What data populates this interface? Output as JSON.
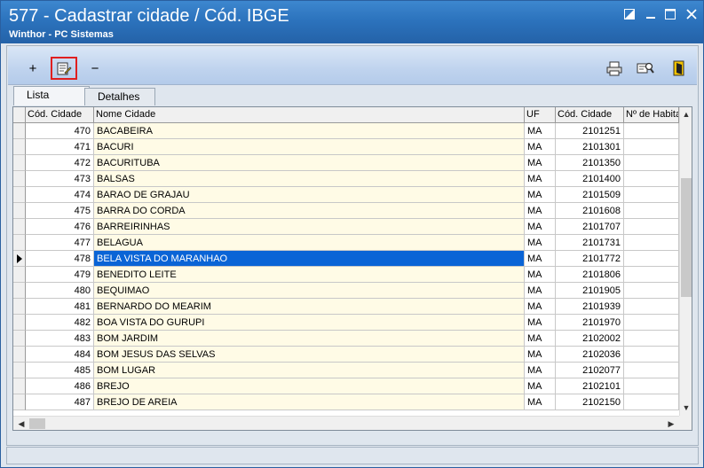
{
  "window": {
    "title": "577 - Cadastrar cidade / Cód. IBGE",
    "subtitle": "Winthor - PC Sistemas",
    "controls": [
      "restore-icon",
      "minimize-icon",
      "maximize-icon",
      "close-icon"
    ]
  },
  "toolbar": {
    "add": "+",
    "minus": "−",
    "buttons": [
      "add-icon",
      "edit-record-icon",
      "remove-icon",
      "print-icon",
      "search-icon",
      "exit-door-icon"
    ],
    "highlight_color": "#e01f1f"
  },
  "tabs": [
    {
      "label": "Lista",
      "active": true
    },
    {
      "label": "Detalhes",
      "active": false
    }
  ],
  "grid": {
    "columns": [
      "Cód. Cidade",
      "Nome Cidade",
      "UF",
      "Cód. Cidade",
      "Nº de Habita"
    ],
    "rows": [
      {
        "cod": "470",
        "nome": "BACABEIRA",
        "uf": "MA",
        "ibge": "2101251"
      },
      {
        "cod": "471",
        "nome": "BACURI",
        "uf": "MA",
        "ibge": "2101301"
      },
      {
        "cod": "472",
        "nome": "BACURITUBA",
        "uf": "MA",
        "ibge": "2101350"
      },
      {
        "cod": "473",
        "nome": "BALSAS",
        "uf": "MA",
        "ibge": "2101400"
      },
      {
        "cod": "474",
        "nome": "BARAO DE GRAJAU",
        "uf": "MA",
        "ibge": "2101509"
      },
      {
        "cod": "475",
        "nome": "BARRA DO CORDA",
        "uf": "MA",
        "ibge": "2101608"
      },
      {
        "cod": "476",
        "nome": "BARREIRINHAS",
        "uf": "MA",
        "ibge": "2101707"
      },
      {
        "cod": "477",
        "nome": "BELAGUA",
        "uf": "MA",
        "ibge": "2101731"
      },
      {
        "cod": "478",
        "nome": "BELA VISTA DO MARANHAO",
        "uf": "MA",
        "ibge": "2101772",
        "selected": true
      },
      {
        "cod": "479",
        "nome": "BENEDITO LEITE",
        "uf": "MA",
        "ibge": "2101806"
      },
      {
        "cod": "480",
        "nome": "BEQUIMAO",
        "uf": "MA",
        "ibge": "2101905"
      },
      {
        "cod": "481",
        "nome": "BERNARDO DO MEARIM",
        "uf": "MA",
        "ibge": "2101939"
      },
      {
        "cod": "482",
        "nome": "BOA VISTA DO GURUPI",
        "uf": "MA",
        "ibge": "2101970"
      },
      {
        "cod": "483",
        "nome": "BOM JARDIM",
        "uf": "MA",
        "ibge": "2102002"
      },
      {
        "cod": "484",
        "nome": "BOM JESUS DAS SELVAS",
        "uf": "MA",
        "ibge": "2102036"
      },
      {
        "cod": "485",
        "nome": "BOM LUGAR",
        "uf": "MA",
        "ibge": "2102077"
      },
      {
        "cod": "486",
        "nome": "BREJO",
        "uf": "MA",
        "ibge": "2102101"
      },
      {
        "cod": "487",
        "nome": "BREJO DE AREIA",
        "uf": "MA",
        "ibge": "2102150"
      }
    ],
    "selected_index": 8,
    "selection_color": "#0a64d6",
    "name_column_color": "#fffbe6"
  }
}
